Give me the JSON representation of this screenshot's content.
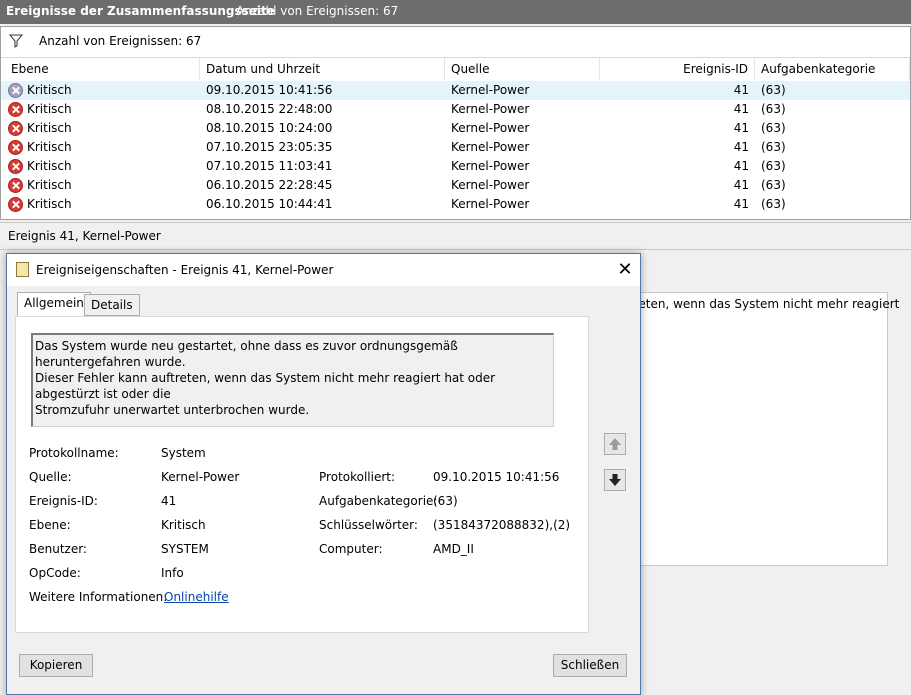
{
  "header": {
    "title": "Ereignisse der Zusammenfassungsseite",
    "count_text": "Anzahl von Ereignissen: 67"
  },
  "filter": {
    "text": "Anzahl von Ereignissen: 67"
  },
  "table": {
    "columns": [
      "Ebene",
      "Datum und Uhrzeit",
      "Quelle",
      "Ereignis-ID",
      "Aufgabenkategorie"
    ],
    "rows": [
      {
        "level": "Kritisch",
        "datetime": "09.10.2015 10:41:56",
        "source": "Kernel-Power",
        "id": "41",
        "category": "(63)"
      },
      {
        "level": "Kritisch",
        "datetime": "08.10.2015 22:48:00",
        "source": "Kernel-Power",
        "id": "41",
        "category": "(63)"
      },
      {
        "level": "Kritisch",
        "datetime": "08.10.2015 10:24:00",
        "source": "Kernel-Power",
        "id": "41",
        "category": "(63)"
      },
      {
        "level": "Kritisch",
        "datetime": "07.10.2015 23:05:35",
        "source": "Kernel-Power",
        "id": "41",
        "category": "(63)"
      },
      {
        "level": "Kritisch",
        "datetime": "07.10.2015 11:03:41",
        "source": "Kernel-Power",
        "id": "41",
        "category": "(63)"
      },
      {
        "level": "Kritisch",
        "datetime": "06.10.2015 22:28:45",
        "source": "Kernel-Power",
        "id": "41",
        "category": "(63)"
      },
      {
        "level": "Kritisch",
        "datetime": "06.10.2015 10:44:41",
        "source": "Kernel-Power",
        "id": "41",
        "category": "(63)"
      }
    ]
  },
  "detail": {
    "header": "Ereignis 41, Kernel-Power",
    "background_text": "ftreten, wenn das System nicht mehr reagiert"
  },
  "dialog": {
    "title": "Ereigniseigenschaften - Ereignis 41, Kernel-Power",
    "close": "✕",
    "tabs": [
      "Allgemein",
      "Details"
    ],
    "description_lines": [
      "Das System wurde neu gestartet, ohne dass es zuvor ordnungsgemäß heruntergefahren wurde.",
      "Dieser Fehler kann auftreten, wenn das System nicht mehr reagiert hat oder abgestürzt ist oder die",
      "Stromzufuhr unerwartet unterbrochen wurde."
    ],
    "fields": {
      "protokollname_label": "Protokollname:",
      "protokollname": "System",
      "quelle_label": "Quelle:",
      "quelle": "Kernel-Power",
      "protokolliert_label": "Protokolliert:",
      "protokolliert": "09.10.2015 10:41:56",
      "id_label": "Ereignis-ID:",
      "id": "41",
      "aufgabe_label": "Aufgabenkategorie:",
      "aufgabe": "(63)",
      "ebene_label": "Ebene:",
      "ebene": "Kritisch",
      "schluessel_label": "Schlüsselwörter:",
      "schluessel": "(35184372088832),(2)",
      "benutzer_label": "Benutzer:",
      "benutzer": "SYSTEM",
      "computer_label": "Computer:",
      "computer": "AMD_II",
      "opcode_label": "OpCode:",
      "opcode": "Info",
      "info_label": "Weitere Informationen:",
      "info_link": "Onlinehilfe"
    },
    "buttons": {
      "copy": "Kopieren",
      "close": "Schließen"
    }
  },
  "icons": {
    "filter": "filter-icon",
    "error": "error-icon",
    "up": "arrow-up-icon",
    "down": "arrow-down-icon"
  }
}
